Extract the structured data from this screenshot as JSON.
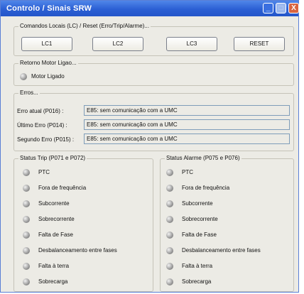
{
  "window": {
    "title": "Controlo / Sinais SRW"
  },
  "titlebar": {
    "minimize": "_",
    "maximize": "□",
    "close": "X"
  },
  "commands": {
    "legend": "Comandos Locais (LC) / Reset (Erro/Trip/Alarme)...",
    "buttons": [
      "LC1",
      "LC2",
      "LC3",
      "RESET"
    ]
  },
  "motor": {
    "legend": "Retorno Motor Ligao...",
    "status_label": "Motor Ligado"
  },
  "errors": {
    "legend": "Erros...",
    "rows": [
      {
        "label": "Erro atual (P016) :",
        "value": "E85: sem comunicação com a UMC"
      },
      {
        "label": "Último Erro (P014) :",
        "value": "E85: sem comunicação com a UMC"
      },
      {
        "label": "Segundo Erro (P015) :",
        "value": "E85: sem comunicação com a UMC"
      }
    ]
  },
  "trip": {
    "legend": "Status Trip (P071 e P072)",
    "items": [
      "PTC",
      "Fora de frequência",
      "Subcorrente",
      "Sobrecorrente",
      "Falta de Fase",
      "Desbalanceamento entre fases",
      "Falta à terra",
      "Sobrecarga"
    ]
  },
  "alarm": {
    "legend": "Status Alarme (P075 e P076)",
    "items": [
      "PTC",
      "Fora de frequência",
      "Subcorrente",
      "Sobrecorrente",
      "Falta de Fase",
      "Desbalanceamento entre fases",
      "Falta à terra",
      "Sobrecarga"
    ]
  }
}
